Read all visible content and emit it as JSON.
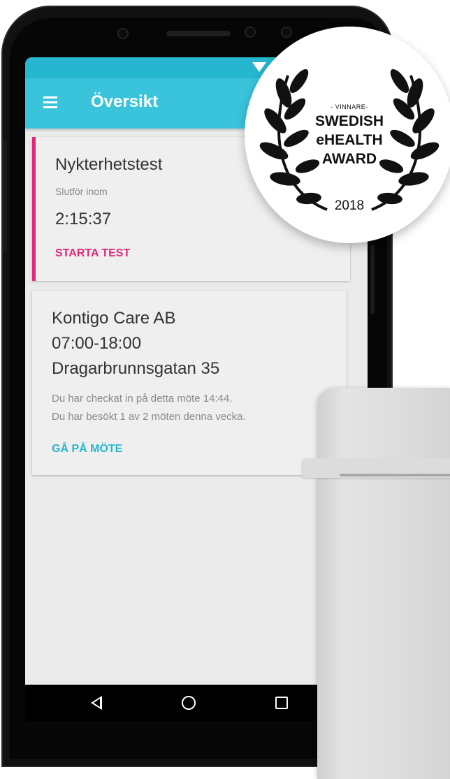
{
  "app": {
    "title": "Översikt",
    "accent_color": "#39c4dc",
    "status_bar_color": "#26b6cf",
    "alert_color": "#e0287a"
  },
  "test_card": {
    "title": "Nykterhetstest",
    "subtitle": "Slutför inom",
    "countdown": "2:15:37",
    "action": "STARTA TEST"
  },
  "meeting_card": {
    "organization": "Kontigo Care AB",
    "hours": "07:00-18:00",
    "address": "Dragarbrunnsgatan 35",
    "checkin_info": "Du har checkat in på detta möte 14:44.",
    "visit_info": "Du har besökt 1 av 2 möten denna vecka.",
    "action": "GÅ PÅ MÖTE"
  },
  "award": {
    "prefix": "- VINNARE-",
    "line1": "SWEDISH",
    "line2": "eHEALTH",
    "line3": "AWARD",
    "year": "2018"
  },
  "icons": {
    "menu": "menu-icon",
    "wifi": "wifi-icon",
    "back": "nav-back-icon",
    "home": "nav-home-icon",
    "recent": "nav-recent-icon"
  }
}
